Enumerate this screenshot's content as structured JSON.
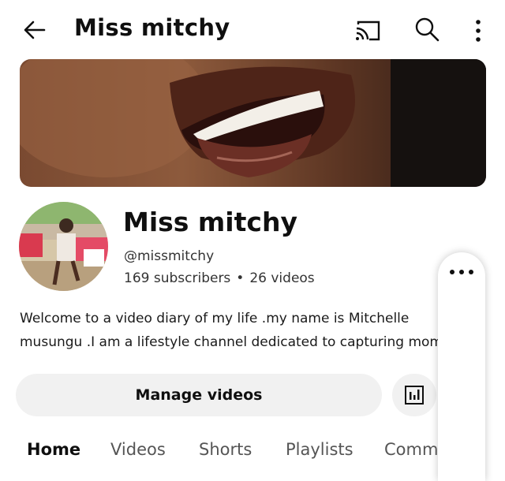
{
  "header": {
    "title": "Miss mitchy",
    "icons": [
      "back-arrow-icon",
      "cast-icon",
      "search-icon",
      "more-vertical-icon"
    ]
  },
  "channel": {
    "name": "Miss mitchy",
    "handle": "@missmitchy",
    "subscribers": "169 subscribers",
    "separator": "•",
    "videos": "26 videos",
    "description_line1": "Welcome to a video diary of my life .my name is Mitchelle",
    "description_line2": "musungu .I am a lifestyle channel dedicated to capturing moments"
  },
  "actions": {
    "manage_label": "Manage videos",
    "analytics_icon": "analytics-icon",
    "overflow_icon": "more-horizontal-icon"
  },
  "tabs": [
    "Home",
    "Videos",
    "Shorts",
    "Playlists",
    "Comm"
  ],
  "colors": {
    "text": "#0f0f0f",
    "button_bg": "#f1f1f1"
  }
}
